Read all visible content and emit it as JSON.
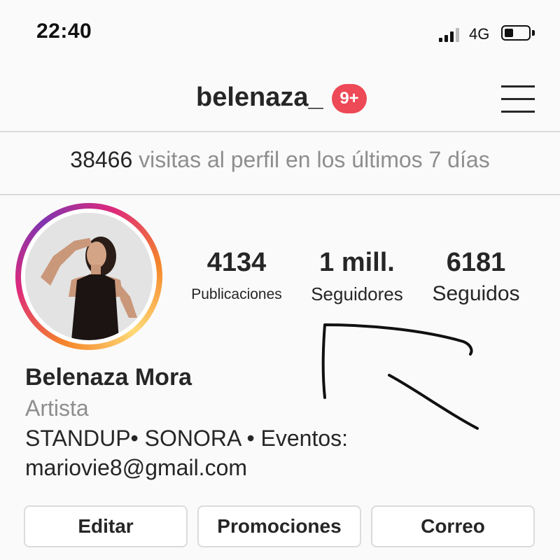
{
  "status_bar": {
    "time": "22:40",
    "network": "4G",
    "signal_bars": 4,
    "battery_level": 0.3
  },
  "header": {
    "username": "belenaza_",
    "notification_badge": "9+",
    "menu_icon": "hamburger-menu-icon"
  },
  "insights": {
    "count": "38466",
    "text": "visitas al perfil en los últimos 7 días"
  },
  "stats": [
    {
      "value": "4134",
      "label": "Publicaciones"
    },
    {
      "value": "1 mill.",
      "label": "Seguidores"
    },
    {
      "value": "6181",
      "label": "Seguidos"
    }
  ],
  "bio": {
    "name": "Belenaza Mora",
    "category": "Artista",
    "line1": "STANDUP• SONORA • Eventos:",
    "line2": "mariovie8@gmail.com"
  },
  "buttons": {
    "edit": "Editar",
    "promotions": "Promociones",
    "email": "Correo"
  },
  "colors": {
    "badge": "#ed4956",
    "muted_text": "#8e8e8e",
    "divider": "#dbdbdb"
  }
}
